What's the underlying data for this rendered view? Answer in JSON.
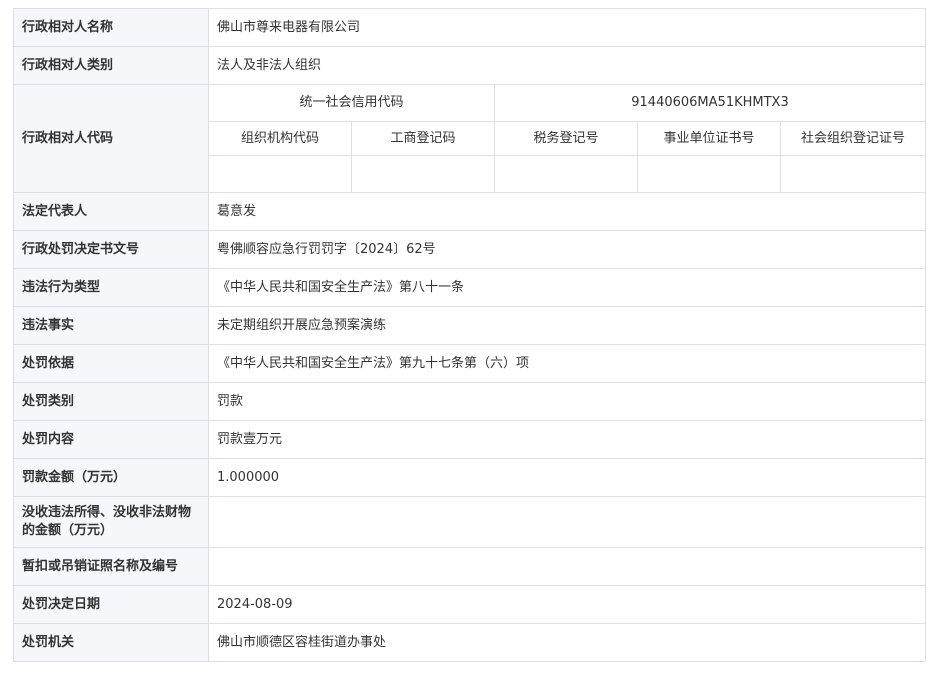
{
  "rows": {
    "name": {
      "label": "行政相对人名称",
      "value": "佛山市尊来电器有限公司"
    },
    "category": {
      "label": "行政相对人类别",
      "value": "法人及非法人组织"
    },
    "code": {
      "label": "行政相对人代码",
      "credit_code_label": "统一社会信用代码",
      "credit_code_value": "91440606MA51KHMTX3",
      "sub_headers": [
        "组织机构代码",
        "工商登记码",
        "税务登记号",
        "事业单位证书号",
        "社会组织登记证号"
      ],
      "sub_values": [
        "",
        "",
        "",
        "",
        ""
      ]
    },
    "legal_rep": {
      "label": "法定代表人",
      "value": "葛意发"
    },
    "decision_no": {
      "label": "行政处罚决定书文号",
      "value": "粤佛顺容应急行罚罚字〔2024〕62号"
    },
    "violation_type": {
      "label": "违法行为类型",
      "value": "《中华人民共和国安全生产法》第八十一条"
    },
    "violation_fact": {
      "label": "违法事实",
      "value": "未定期组织开展应急预案演练"
    },
    "basis": {
      "label": "处罚依据",
      "value": "《中华人民共和国安全生产法》第九十七条第（六）项"
    },
    "penalty_type": {
      "label": "处罚类别",
      "value": "罚款"
    },
    "penalty_content": {
      "label": "处罚内容",
      "value": "罚款壹万元"
    },
    "fine_amount": {
      "label": "罚款金额（万元）",
      "value": "1.000000"
    },
    "confiscation": {
      "label_line1": "没收违法所得、没收非法财物",
      "label_line2": "的金额（万元）",
      "value": ""
    },
    "license_revoke": {
      "label": "暂扣或吊销证照名称及编号",
      "value": ""
    },
    "decision_date": {
      "label": "处罚决定日期",
      "value": "2024-08-09"
    },
    "authority": {
      "label": "处罚机关",
      "value": "佛山市顺德区容桂街道办事处"
    }
  }
}
